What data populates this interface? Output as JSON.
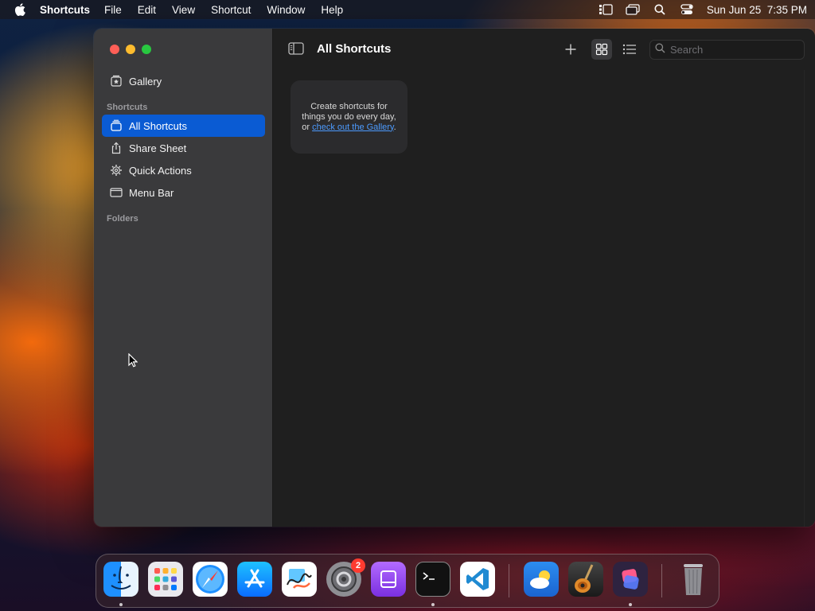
{
  "menubar": {
    "app_name": "Shortcuts",
    "menus": [
      "File",
      "Edit",
      "View",
      "Shortcut",
      "Window",
      "Help"
    ],
    "datetime": "Sun Jun 25  7:35 PM"
  },
  "sidebar": {
    "gallery_label": "Gallery",
    "shortcuts_heading": "Shortcuts",
    "items": [
      {
        "label": "All Shortcuts",
        "icon": "stack-icon",
        "selected": true
      },
      {
        "label": "Share Sheet",
        "icon": "share-icon",
        "selected": false
      },
      {
        "label": "Quick Actions",
        "icon": "gear-icon",
        "selected": false
      },
      {
        "label": "Menu Bar",
        "icon": "menubar-icon",
        "selected": false
      }
    ],
    "folders_heading": "Folders"
  },
  "toolbar": {
    "title": "All Shortcuts",
    "search_placeholder": "Search"
  },
  "empty_state": {
    "text_before": "Create shortcuts for things you do every day, or ",
    "link_text": "check out the Gallery",
    "text_after": "."
  },
  "dock": {
    "apps": [
      "Finder",
      "Launchpad",
      "Safari",
      "App Store",
      "Freeform",
      "System Settings",
      "Apple Configurator",
      "Terminal",
      "Visual Studio Code",
      "Weather",
      "GarageBand",
      "Shortcuts",
      "Trash"
    ],
    "settings_badge": "2"
  },
  "colors": {
    "accent": "#0a5bd3",
    "link": "#4c9bff",
    "sidebar_bg": "#3a3a3c",
    "main_bg": "#1f1f1f"
  }
}
